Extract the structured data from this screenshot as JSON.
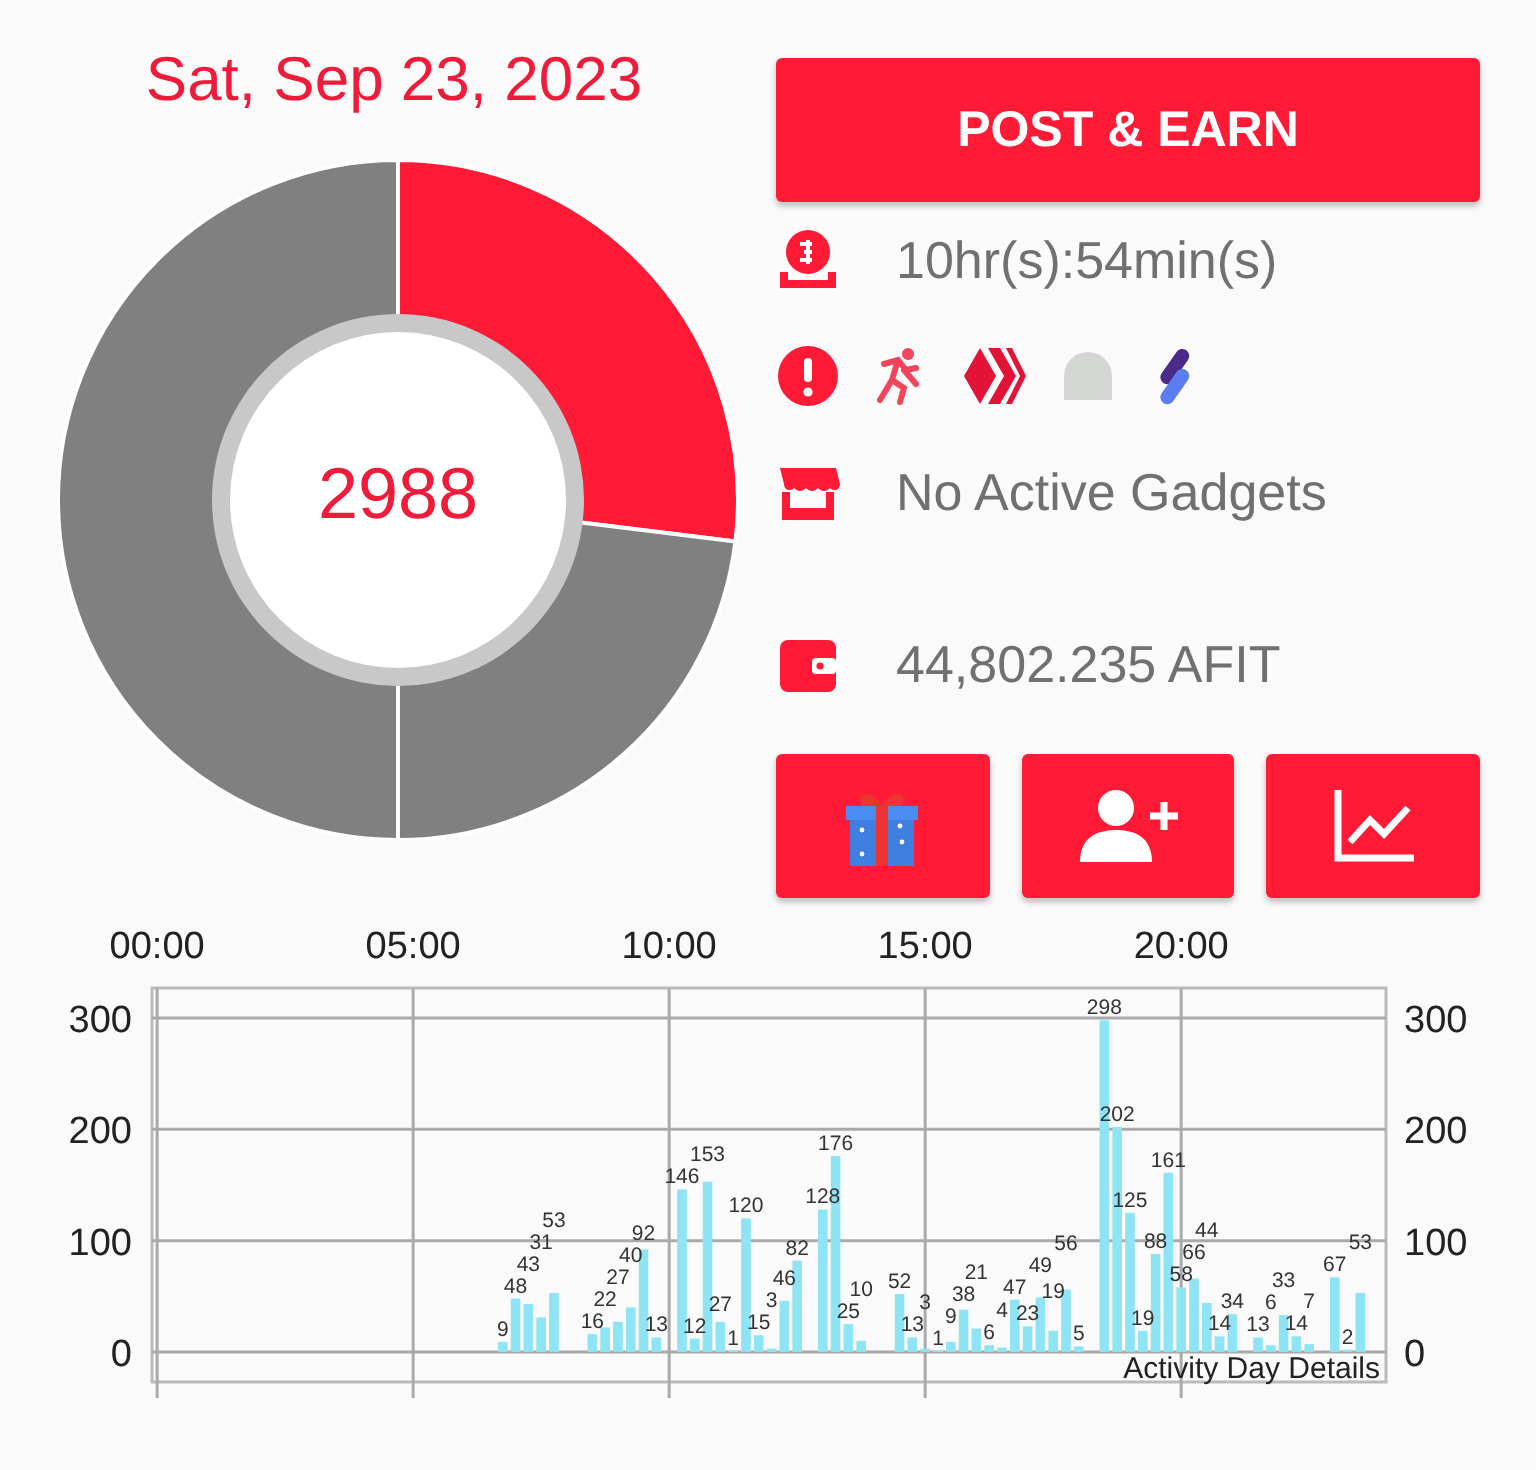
{
  "date": "Sat, Sep 23, 2023",
  "total": "2988",
  "post_button": "POST & EARN",
  "timer": "10hr(s):54min(s)",
  "gadgets": "No Active Gadgets",
  "balance": "44,802.235 AFIT",
  "activity": {
    "description": "Activity Day Details",
    "left_axis_labels": [
      "300",
      "200",
      "100",
      "0"
    ],
    "chart_data": {
      "type": "bar",
      "data_labels": true,
      "xlim": [
        -0.1,
        24
      ],
      "ylim": [
        -27,
        327
      ],
      "xticks": [
        {
          "value": 0,
          "label": "00:00"
        },
        {
          "value": 5,
          "label": "05:00"
        },
        {
          "value": 10,
          "label": "10:00"
        },
        {
          "value": 15,
          "label": "15:00"
        },
        {
          "value": 20,
          "label": "20:00"
        }
      ],
      "grid": true,
      "yticks": [
        0,
        100,
        200,
        300
      ],
      "x": [
        6.75,
        7,
        7.25,
        7.5,
        7.75,
        8.5,
        8.75,
        9,
        9.25,
        9.5,
        9.75,
        10.25,
        10.5,
        10.75,
        11,
        11.25,
        11.5,
        11.75,
        12,
        12.25,
        12.5,
        13,
        13.25,
        13.5,
        13.75,
        14.5,
        14.75,
        15,
        15.25,
        15.5,
        15.75,
        16,
        16.25,
        16.5,
        16.75,
        17,
        17.25,
        17.5,
        17.75,
        18,
        18.5,
        18.75,
        19,
        19.25,
        19.5,
        19.75,
        20,
        20.25,
        20.5,
        20.75,
        21,
        21.5,
        21.75,
        22,
        22.25,
        22.5,
        23,
        23.25,
        23.5
      ],
      "values": [
        9,
        48,
        43,
        31,
        53,
        16,
        22,
        27,
        40,
        92,
        13,
        146,
        12,
        153,
        27,
        1,
        120,
        15,
        3,
        46,
        82,
        128,
        176,
        25,
        10,
        52,
        13,
        3,
        1,
        9,
        38,
        21,
        6,
        4,
        47,
        23,
        49,
        19,
        56,
        5,
        298,
        202,
        125,
        19,
        88,
        161,
        58,
        66,
        44,
        14,
        34,
        13,
        6,
        33,
        14,
        7,
        67,
        2,
        53
      ]
    }
  }
}
